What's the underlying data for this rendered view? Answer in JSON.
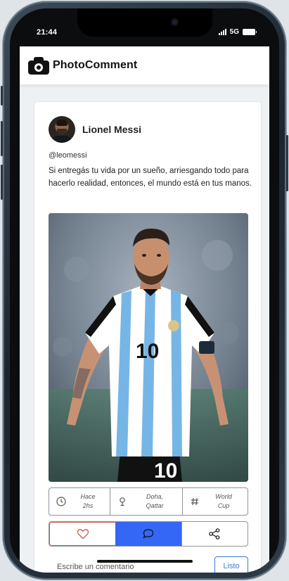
{
  "status_bar": {
    "time": "21:44",
    "network": "5G"
  },
  "app": {
    "title": "PhotoComment",
    "logo_icon": "camera-icon"
  },
  "post": {
    "user_name": "Lionel Messi",
    "handle": "@leomessi",
    "caption": "Si entregás tu vida por un sueño, arriesgando todo para hacerlo realidad, entonces, el mundo está en tus manos.",
    "photo": {
      "jersey_number": "10"
    },
    "meta": {
      "time_line1": "Hace",
      "time_line2": "2hs",
      "location_line1": "Doha,",
      "location_line2": "Qattar",
      "tag_line1": "World",
      "tag_line2": "Cup"
    }
  },
  "actions": {
    "like_icon": "heart-icon",
    "comment_icon": "comment-bubble-icon",
    "share_icon": "share-icon"
  },
  "comment_box": {
    "placeholder": "Escribe un comentario",
    "submit_label": "Listo"
  },
  "colors": {
    "accent_blue": "#3467f6",
    "like_border": "#c9584a",
    "submit_blue": "#3d7ad9"
  }
}
